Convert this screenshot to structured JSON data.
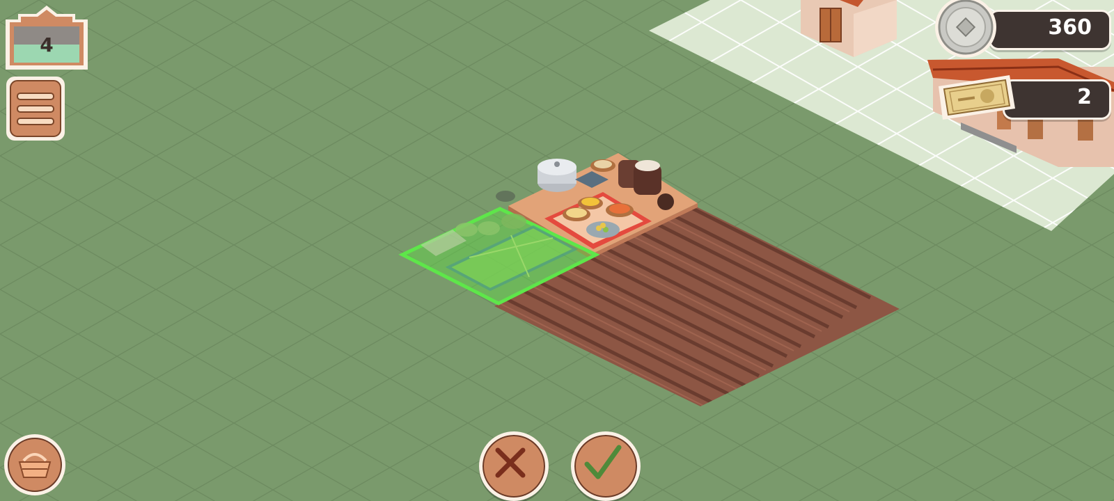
{
  "hud": {
    "level": "4",
    "coins": "360",
    "banknotes": "2"
  },
  "icons": {
    "menu": "hamburger-menu-icon",
    "coin": "silver-coin-icon",
    "banknote": "banknote-icon",
    "shop": "basket-icon",
    "cancel": "x-icon",
    "confirm": "check-icon"
  },
  "colors": {
    "grass": "#7a9a6c",
    "soil": "#8a5544",
    "placement_valid": "#5ddc4a",
    "button": "#cf8a63",
    "cancel_mark": "#7a2e1c",
    "confirm_mark": "#4f8a3a",
    "pill_dark": "#3e3431"
  }
}
